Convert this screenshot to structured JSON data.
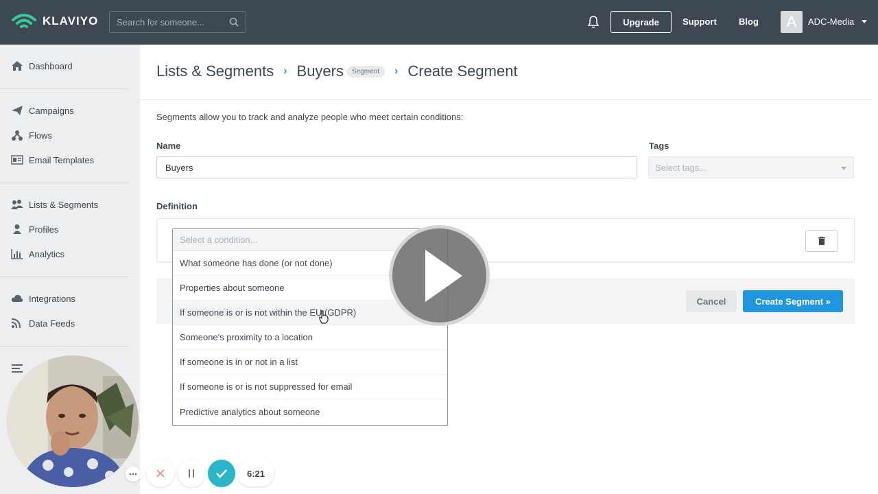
{
  "app": {
    "logo": "KLAVIYO"
  },
  "topbar": {
    "search_placeholder": "Search for someone...",
    "upgrade": "Upgrade",
    "support": "Support",
    "blog": "Blog",
    "avatar_letter": "A",
    "account": "ADC-Media"
  },
  "sidebar": {
    "items": [
      {
        "label": "Dashboard",
        "icon": "home-icon"
      },
      {
        "label": "Campaigns",
        "icon": "paper-plane-icon"
      },
      {
        "label": "Flows",
        "icon": "flows-icon"
      },
      {
        "label": "Email Templates",
        "icon": "template-icon"
      },
      {
        "label": "Lists & Segments",
        "icon": "users-icon"
      },
      {
        "label": "Profiles",
        "icon": "user-icon"
      },
      {
        "label": "Analytics",
        "icon": "bar-chart-icon"
      },
      {
        "label": "Integrations",
        "icon": "cloud-icon"
      },
      {
        "label": "Data Feeds",
        "icon": "rss-icon"
      }
    ]
  },
  "breadcrumb": {
    "lists": "Lists & Segments",
    "buyers": "Buyers",
    "pill": "Segment",
    "current": "Create Segment"
  },
  "form": {
    "intro": "Segments allow you to track and analyze people who meet certain conditions:",
    "name_label": "Name",
    "name_value": "Buyers",
    "tags_label": "Tags",
    "tags_placeholder": "Select tags...",
    "definition_label": "Definition",
    "condition_placeholder": "Select a condition...",
    "cancel": "Cancel",
    "create": "Create Segment »"
  },
  "dropdown": {
    "options": [
      "What someone has done (or not done)",
      "Properties about someone",
      "If someone is or is not within the EU (GDPR)",
      "Someone's proximity to a location",
      "If someone is in or not in a list",
      "If someone is or is not suppressed for email",
      "Predictive analytics about someone"
    ],
    "hover_index": 2
  },
  "recorder": {
    "timer": "6:21"
  },
  "colors": {
    "topbar": "#3d4852",
    "accent": "#2196e0",
    "teal": "#2bb5c8"
  }
}
